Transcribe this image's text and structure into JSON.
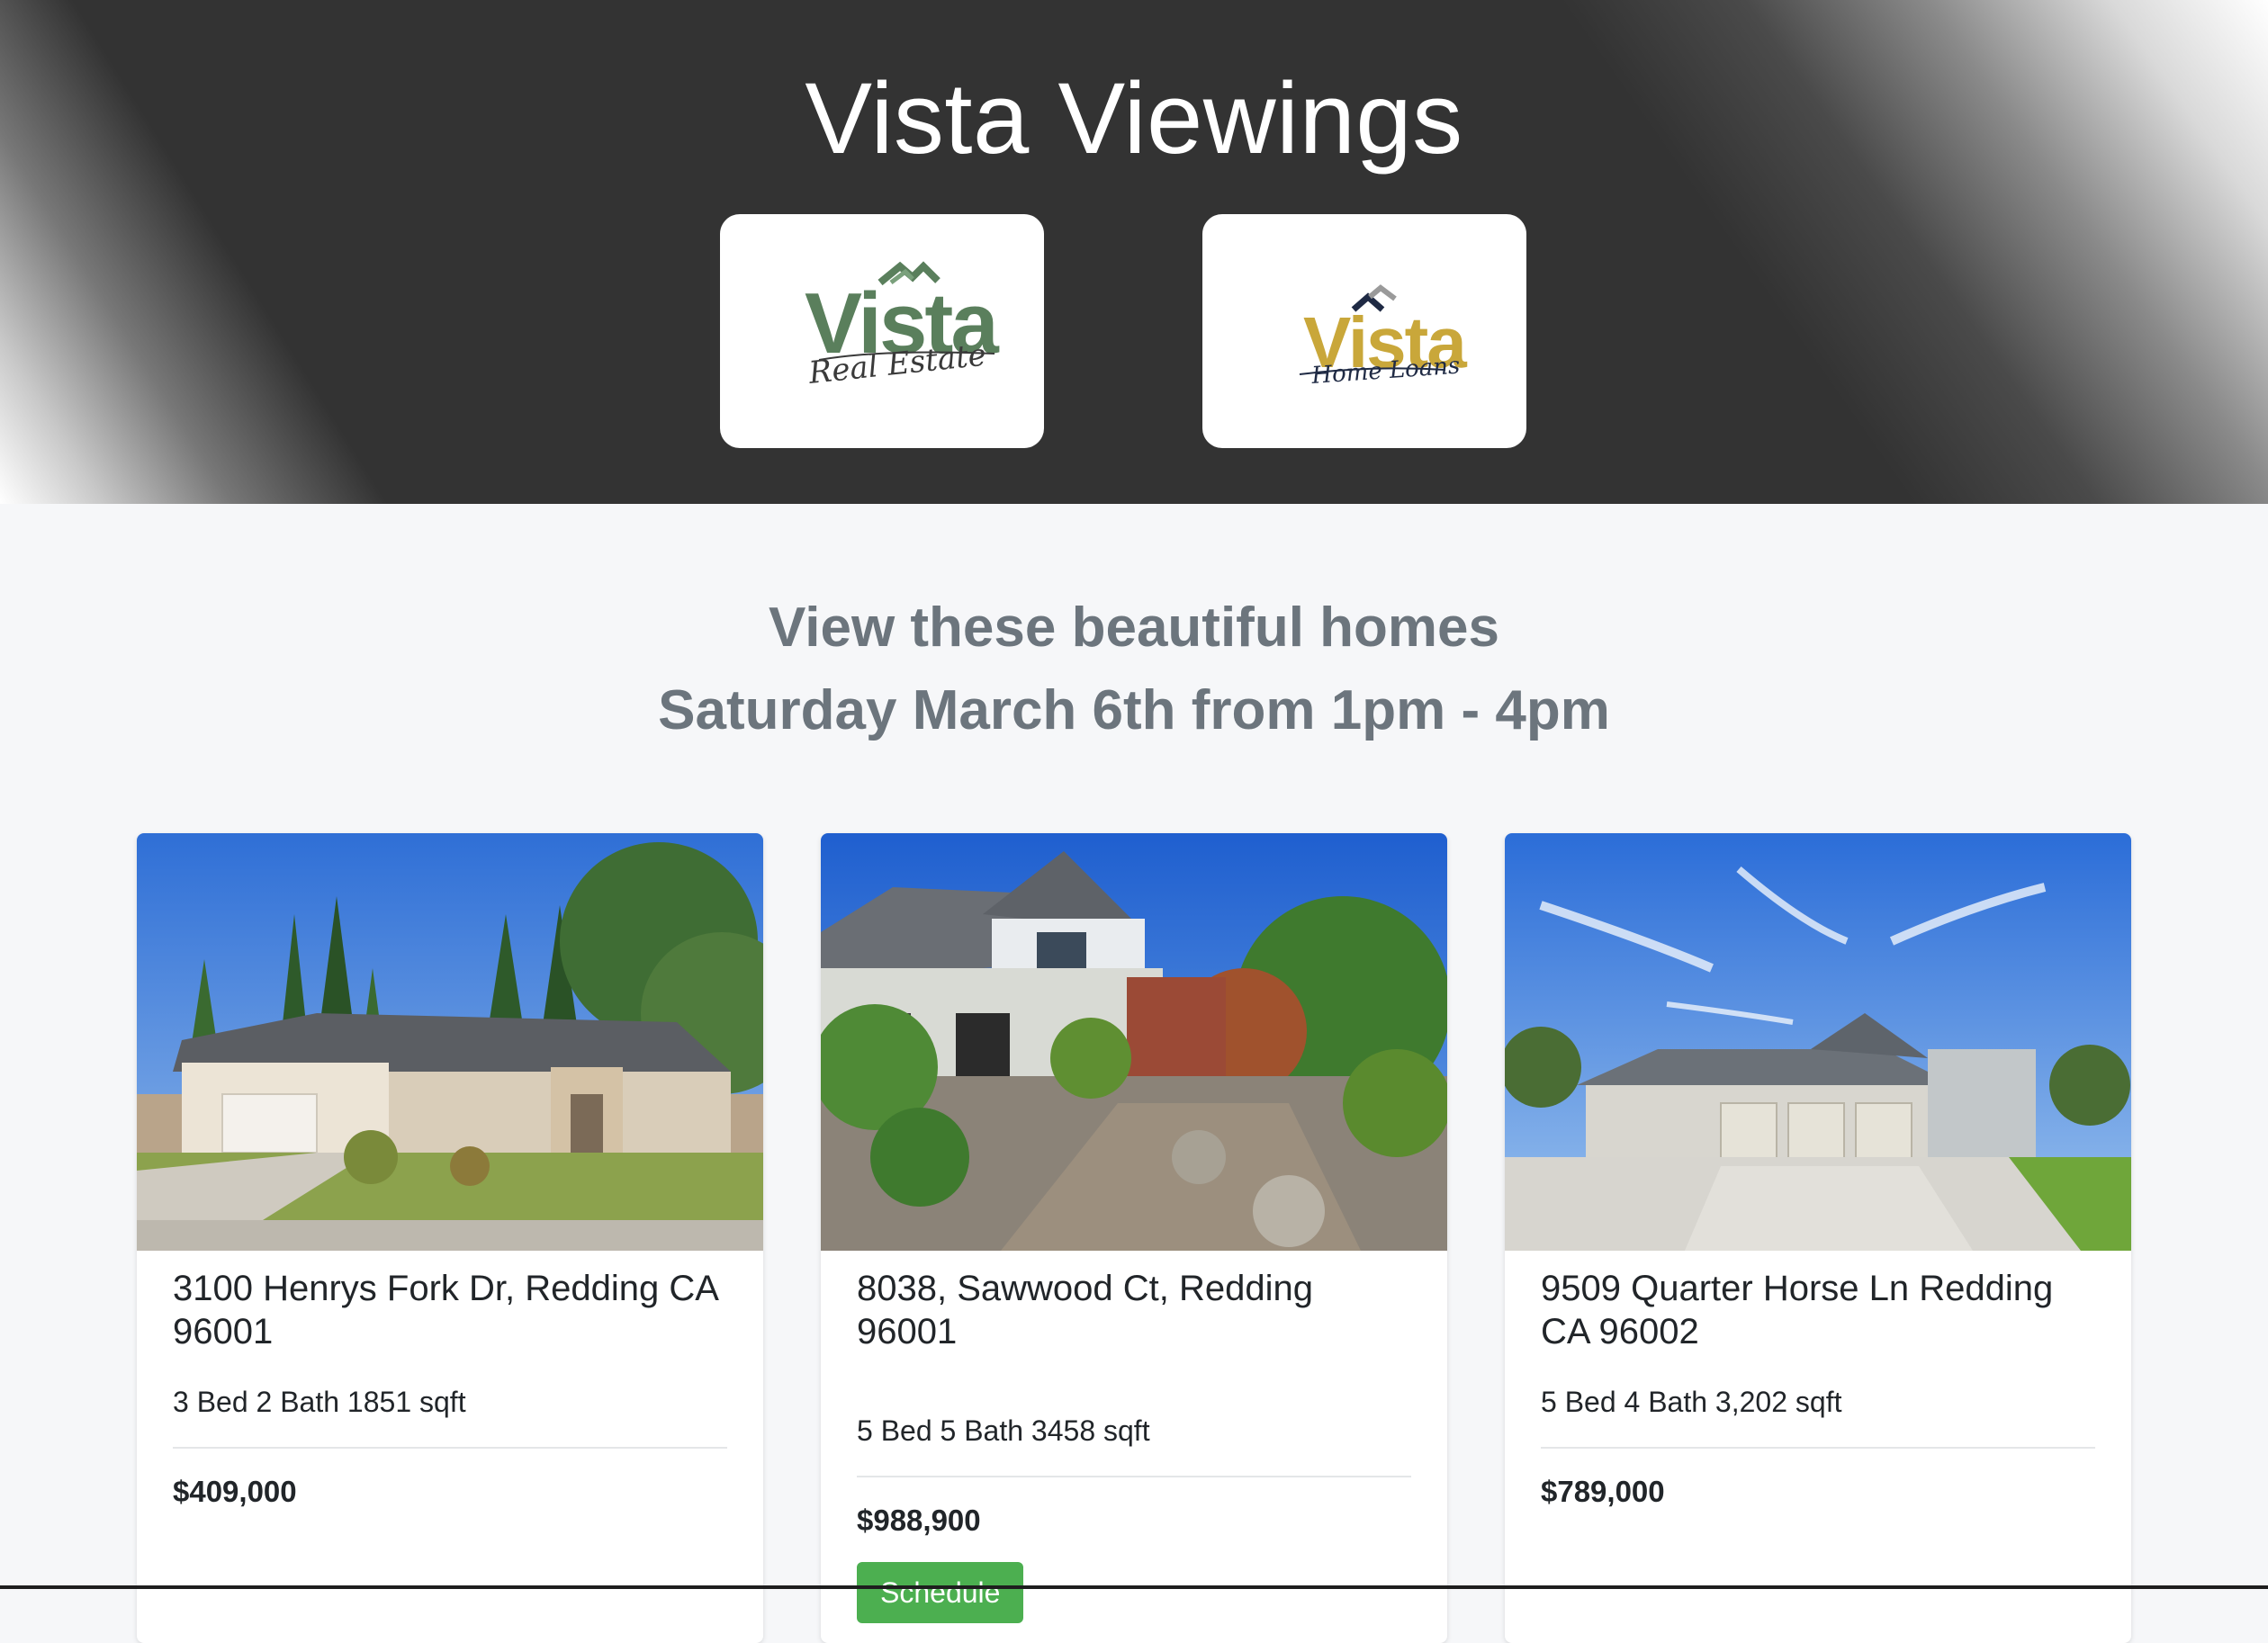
{
  "header": {
    "title": "Vista Viewings",
    "logos": [
      {
        "word": "Vista",
        "script": "Real Estate",
        "word_color": "#5a7f5c",
        "roof_color": "#5a7f5c"
      },
      {
        "word": "Vista",
        "script": "Home Loans",
        "word_color": "#c9a73a",
        "roof_color": "#1f2a44"
      }
    ]
  },
  "intro": {
    "line1": "View these beautiful homes",
    "line2": "Saturday March 6th from 1pm - 4pm"
  },
  "listings": [
    {
      "address": "3100 Henrys Fork Dr, Redding CA 96001",
      "specs": "3 Bed 2 Bath 1851 sqft",
      "price": "$409,000"
    },
    {
      "address": "8038, Sawwood Ct, Redding 96001",
      "specs": "5 Bed 5 Bath 3458 sqft",
      "price": "$988,900",
      "button": "Schedule"
    },
    {
      "address": "9509 Quarter Horse Ln Redding CA 96002",
      "specs": "5 Bed 4 Bath 3,202 sqft",
      "price": "$789,000"
    }
  ],
  "colors": {
    "hero_bg": "#333333",
    "page_bg": "#f6f7f9",
    "intro_text": "#6c757d",
    "button_bg": "#4caf50"
  }
}
